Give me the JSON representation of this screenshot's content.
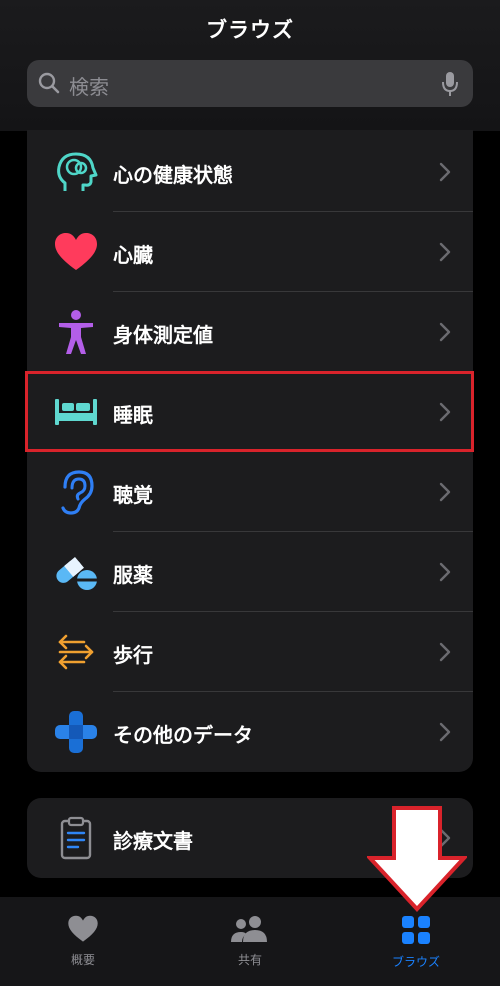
{
  "header": {
    "title": "ブラウズ"
  },
  "search": {
    "placeholder": "検索"
  },
  "categories": [
    {
      "label": "心の健康状態",
      "icon": "head-brain-icon"
    },
    {
      "label": "心臓",
      "icon": "heart-icon"
    },
    {
      "label": "身体測定値",
      "icon": "body-figure-icon"
    },
    {
      "label": "睡眠",
      "icon": "bed-icon"
    },
    {
      "label": "聴覚",
      "icon": "ear-icon"
    },
    {
      "label": "服薬",
      "icon": "pills-icon"
    },
    {
      "label": "歩行",
      "icon": "walking-arrows-icon"
    },
    {
      "label": "その他のデータ",
      "icon": "plus-cross-icon"
    }
  ],
  "records": [
    {
      "label": "診療文書",
      "icon": "clipboard-document-icon"
    }
  ],
  "tabbar": {
    "tabs": [
      {
        "label": "概要",
        "icon": "heart-icon",
        "active": false
      },
      {
        "label": "共有",
        "icon": "people-icon",
        "active": false
      },
      {
        "label": "ブラウズ",
        "icon": "grid-icon",
        "active": true
      }
    ]
  },
  "annotation": {
    "highlighted_item": "睡眠"
  },
  "colors": {
    "accent_blue": "#1a82ff",
    "highlight_red": "#d9232b",
    "heart_red": "#ff3b5c",
    "mental_teal": "#4fd6c8",
    "body_purple": "#b35ee8",
    "sleep_teal": "#5fd8d0",
    "hearing_blue": "#2f7ff5",
    "walking_orange": "#f0a030"
  }
}
